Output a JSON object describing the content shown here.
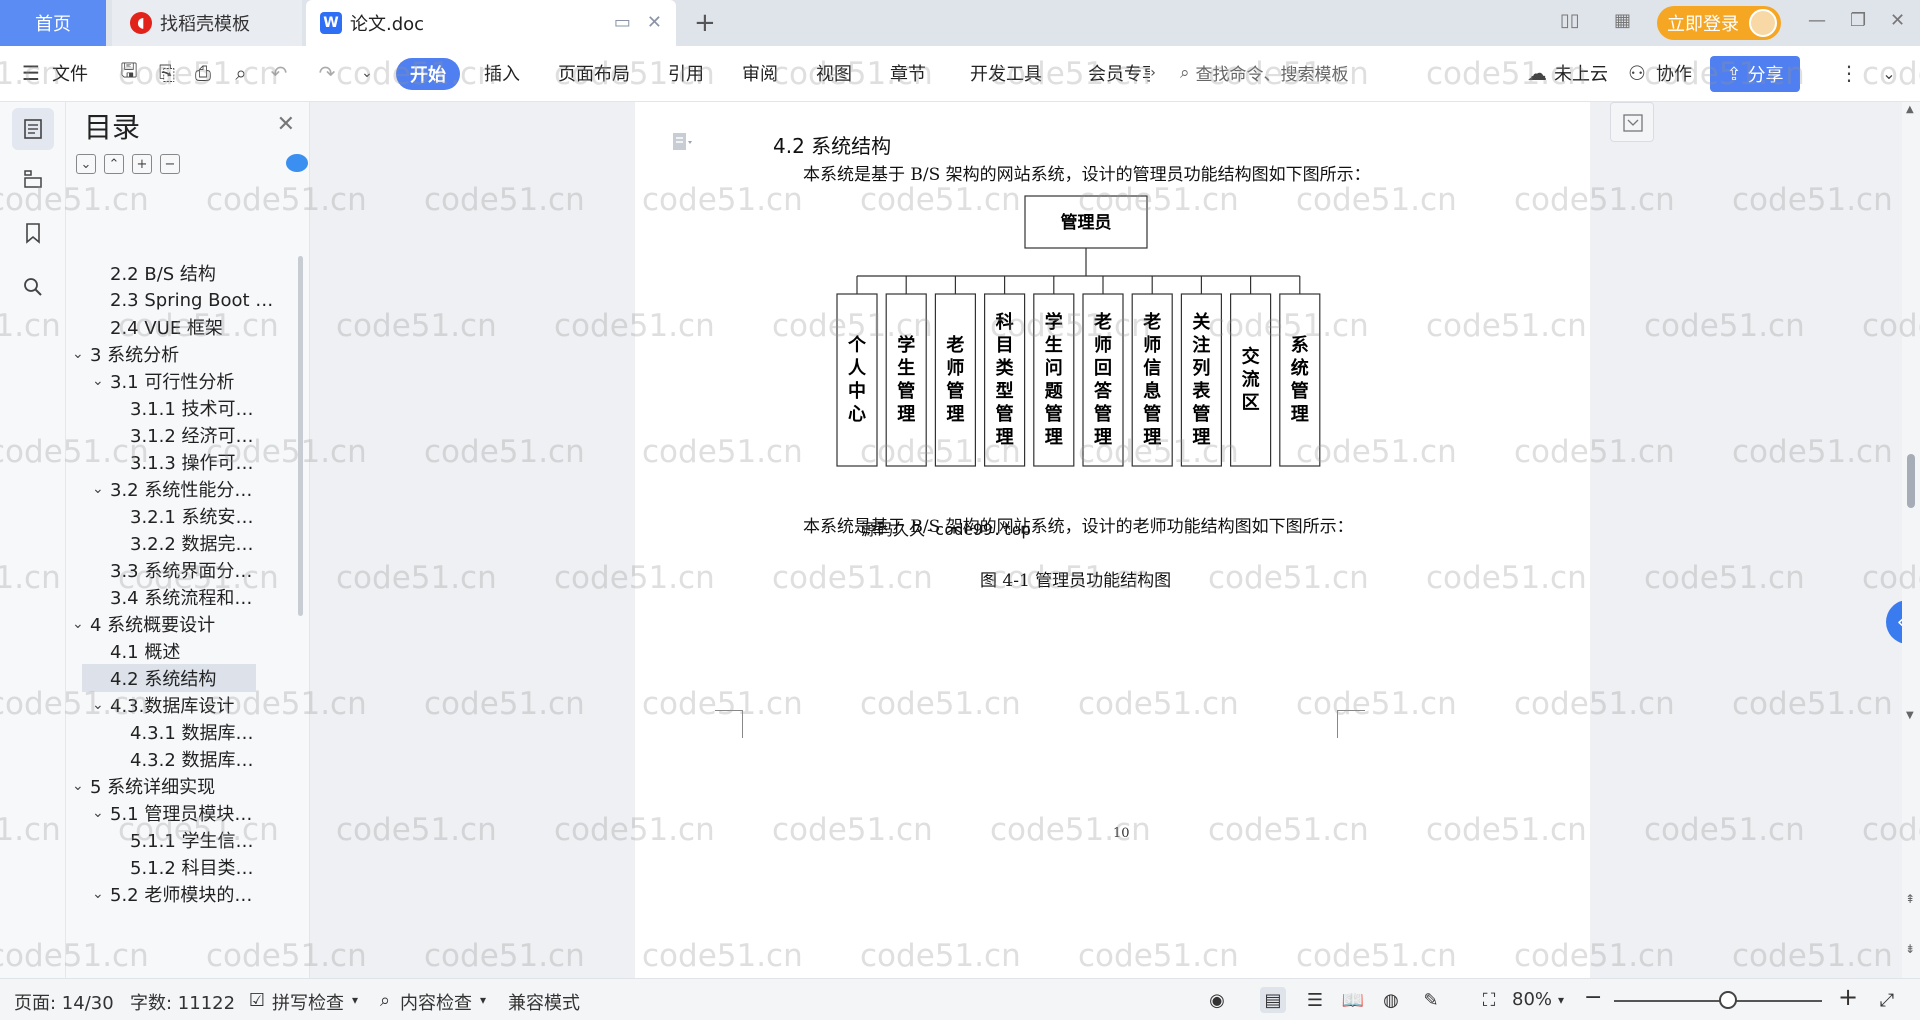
{
  "tabs": {
    "home": "首页",
    "daoke": "找稻壳模板",
    "doc": "论文.doc",
    "login": "立即登录"
  },
  "ribbon": {
    "file": "文件",
    "menus": [
      "开始",
      "插入",
      "页面布局",
      "引用",
      "审阅",
      "视图",
      "章节",
      "开发工具",
      "会员专享"
    ],
    "search": "查找命令、搜索模板",
    "cloud": "未上云",
    "collab": "协作",
    "share": "分享"
  },
  "toc": {
    "title": "目录",
    "items": [
      {
        "label": "2.2 B/S 结构",
        "level": 2,
        "arrow": ""
      },
      {
        "label": "2.3 Spring Boot …",
        "level": 2,
        "arrow": ""
      },
      {
        "label": "2.4 VUE 框架",
        "level": 2,
        "arrow": ""
      },
      {
        "label": "3 系统分析",
        "level": 1,
        "arrow": "v"
      },
      {
        "label": "3.1 可行性分析",
        "level": 2,
        "arrow": "v"
      },
      {
        "label": "3.1.1 技术可…",
        "level": 3,
        "arrow": ""
      },
      {
        "label": "3.1.2 经济可…",
        "level": 3,
        "arrow": ""
      },
      {
        "label": "3.1.3 操作可…",
        "level": 3,
        "arrow": ""
      },
      {
        "label": "3.2 系统性能分…",
        "level": 2,
        "arrow": "v"
      },
      {
        "label": "3.2.1 系统安…",
        "level": 3,
        "arrow": ""
      },
      {
        "label": "3.2.2 数据完…",
        "level": 3,
        "arrow": ""
      },
      {
        "label": "3.3 系统界面分…",
        "level": 2,
        "arrow": ""
      },
      {
        "label": "3.4 系统流程和…",
        "level": 2,
        "arrow": ""
      },
      {
        "label": "4 系统概要设计",
        "level": 1,
        "arrow": "v"
      },
      {
        "label": "4.1 概述",
        "level": 2,
        "arrow": ""
      },
      {
        "label": "4.2 系统结构",
        "level": 2,
        "arrow": "",
        "selected": true
      },
      {
        "label": "4.3.数据库设计",
        "level": 2,
        "arrow": "v"
      },
      {
        "label": "4.3.1 数据库…",
        "level": 3,
        "arrow": ""
      },
      {
        "label": "4.3.2 数据库…",
        "level": 3,
        "arrow": ""
      },
      {
        "label": "5 系统详细实现",
        "level": 1,
        "arrow": "v"
      },
      {
        "label": "5.1 管理员模块…",
        "level": 2,
        "arrow": "v"
      },
      {
        "label": "5.1.1 学生信…",
        "level": 3,
        "arrow": ""
      },
      {
        "label": "5.1.2 科目类…",
        "level": 3,
        "arrow": ""
      },
      {
        "label": "5.2 老师模块的…",
        "level": 2,
        "arrow": "v"
      }
    ]
  },
  "document": {
    "heading": "4.2 系统结构",
    "para1": "本系统是基于 B/S 架构的网站系统，设计的管理员功能结构图如下图所示：",
    "para2": "本系统是基于 B/S 架构的网站系统，设计的老师功能结构图如下图所示：",
    "caption": "图 4-1 管理员功能结构图",
    "source_note": "源码久久-code99.top",
    "page_number": "10",
    "diagram": {
      "root": "管理员",
      "children": [
        "个人中心",
        "学生管理",
        "老师管理",
        "科目类型管理",
        "学生问题管理",
        "老师回答管理",
        "老师信息管理",
        "关注列表管理",
        "交流区",
        "系统管理"
      ]
    }
  },
  "watermark": "code51.cn",
  "status": {
    "page": "页面: 14/30",
    "words": "字数: 11122",
    "spell": "拼写检查",
    "content_check": "内容检查",
    "compat": "兼容模式",
    "zoom": "80%",
    "zoom_level": 0.55
  }
}
